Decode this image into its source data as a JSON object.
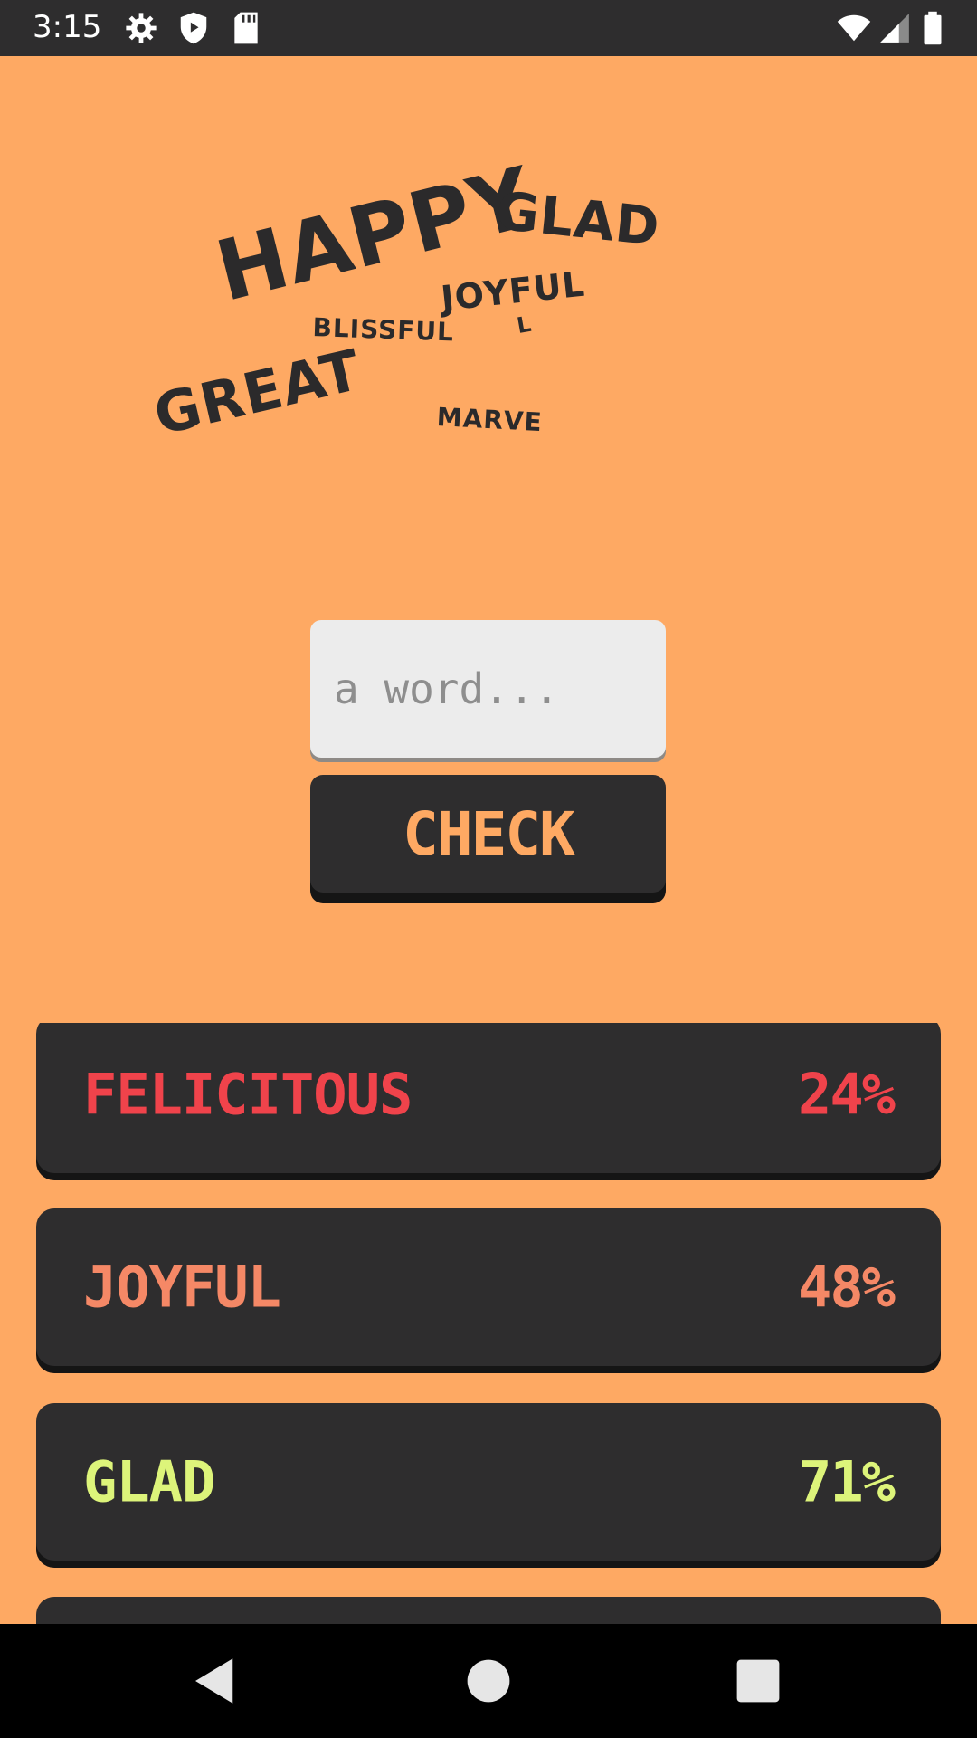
{
  "status_bar": {
    "time": "3:15",
    "icons": [
      "gear-icon",
      "shield-icon",
      "sd-card-icon",
      "wifi-icon",
      "signal-icon",
      "battery-icon"
    ]
  },
  "word_cloud": {
    "words": [
      "HAPPY",
      "GLAD",
      "JOYFUL",
      "L",
      "BLISSFUL",
      "GREAT",
      "MARVE"
    ]
  },
  "input": {
    "placeholder": "a word..."
  },
  "check_button": {
    "label": "CHECK"
  },
  "results": [
    {
      "word": "FELICITOUS",
      "percent": "24%",
      "color": "#F0434B"
    },
    {
      "word": "JOYFUL",
      "percent": "48%",
      "color": "#F58866"
    },
    {
      "word": "GLAD",
      "percent": "71%",
      "color": "#DDF47A"
    },
    {
      "word": "",
      "percent": "",
      "color": "#FFFFFF"
    }
  ],
  "colors": {
    "background": "#FEA963",
    "card": "#2E2D2E",
    "accent": "#FEA963"
  },
  "nav_bar": {
    "icons": [
      "back-icon",
      "home-icon",
      "recents-icon"
    ]
  }
}
